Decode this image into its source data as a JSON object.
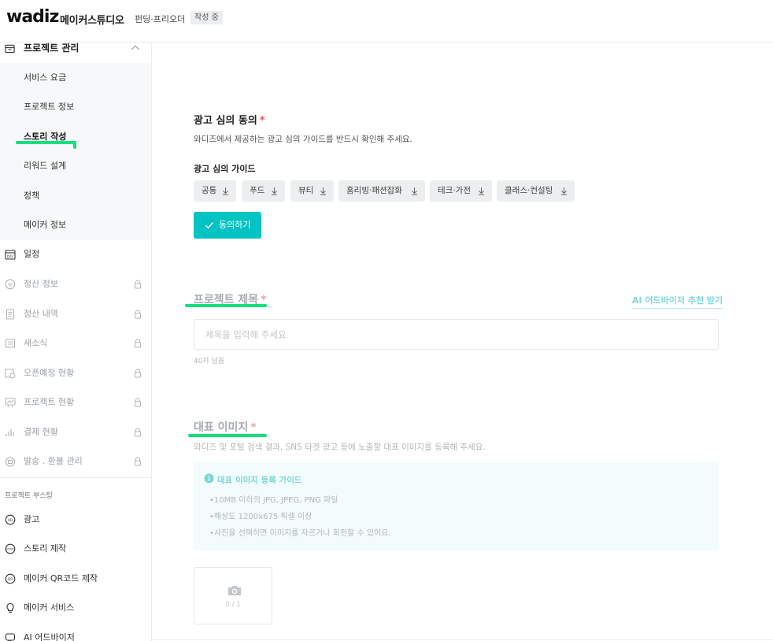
{
  "header": {
    "logo": "wadiz",
    "studio_name": "메이커스튜디오",
    "subtitle": "펀딩·프리오더",
    "status": "작성 중"
  },
  "sidebar": {
    "group_label": "프로젝트 관리",
    "sub_items": [
      {
        "label": "서비스 요금"
      },
      {
        "label": "프로젝트 정보"
      },
      {
        "label": "스토리 작성",
        "active": true
      },
      {
        "label": "리워드 설계"
      },
      {
        "label": "정책"
      },
      {
        "label": "메이커 정보"
      }
    ],
    "menu_items": [
      {
        "label": "일정",
        "icon": "calendar-icon",
        "locked": false
      },
      {
        "label": "정산 정보",
        "icon": "won-coin-icon",
        "locked": true
      },
      {
        "label": "정산 내역",
        "icon": "receipt-icon",
        "locked": true
      },
      {
        "label": "새소식",
        "icon": "news-icon",
        "locked": true
      },
      {
        "label": "오픈예정 현황",
        "icon": "calendar-clock-icon",
        "locked": true
      },
      {
        "label": "프로젝트 현황",
        "icon": "chart-board-icon",
        "locked": true
      },
      {
        "label": "결제 현황",
        "icon": "bar-chart-icon",
        "locked": true
      },
      {
        "label": "발송 . 환불 관리",
        "icon": "box-icon",
        "locked": true
      }
    ],
    "boost_section_title": "프로젝트 부스팅",
    "boost_items": [
      {
        "label": "광고",
        "icon": "ad-icon"
      },
      {
        "label": "스토리 제작",
        "icon": "story-icon"
      },
      {
        "label": "메이커 QR코드 제작",
        "icon": "qr-icon"
      },
      {
        "label": "메이커 서비스",
        "icon": "bulb-icon"
      },
      {
        "label": "AI 어드바이저",
        "icon": "ai-chat-icon"
      }
    ]
  },
  "ad_review": {
    "title": "광고 심의 동의",
    "required_mark": "*",
    "description": "와디즈에서 제공하는 광고 심의 가이드를 반드시 확인해 주세요.",
    "guide_label": "광고 심의 가이드",
    "chips": [
      "공통",
      "푸드",
      "뷰티",
      "홈리빙·패션잡화",
      "테크·가전",
      "클래스·컨설팅"
    ],
    "agree_button": "동의하기"
  },
  "project_title": {
    "title": "프로젝트 제목",
    "required_mark": "*",
    "ai_link": "AI 어드바이저 추천 받기",
    "placeholder": "제목을 입력해 주세요",
    "counter": "40자 남음"
  },
  "main_image": {
    "title": "대표 이미지",
    "required_mark": "*",
    "description": "와디즈 및 포털 검색 결과, SNS 타겟 광고 등에 노출할 대표 이미지를 등록해 주세요.",
    "guide_title": "대표 이미지 등록 가이드",
    "guide_lines": [
      "•10MB 이하의 JPG, JPEG, PNG 파일",
      "•해상도 1200x675 픽셀 이상",
      "•사진을 선택하면 이미지를 자르거나 회전할 수 있어요."
    ],
    "upload_count": "0 / 1"
  },
  "colors": {
    "accent": "#00c4c4",
    "highlight_underline": "#10e07e",
    "required": "#f2545b"
  }
}
